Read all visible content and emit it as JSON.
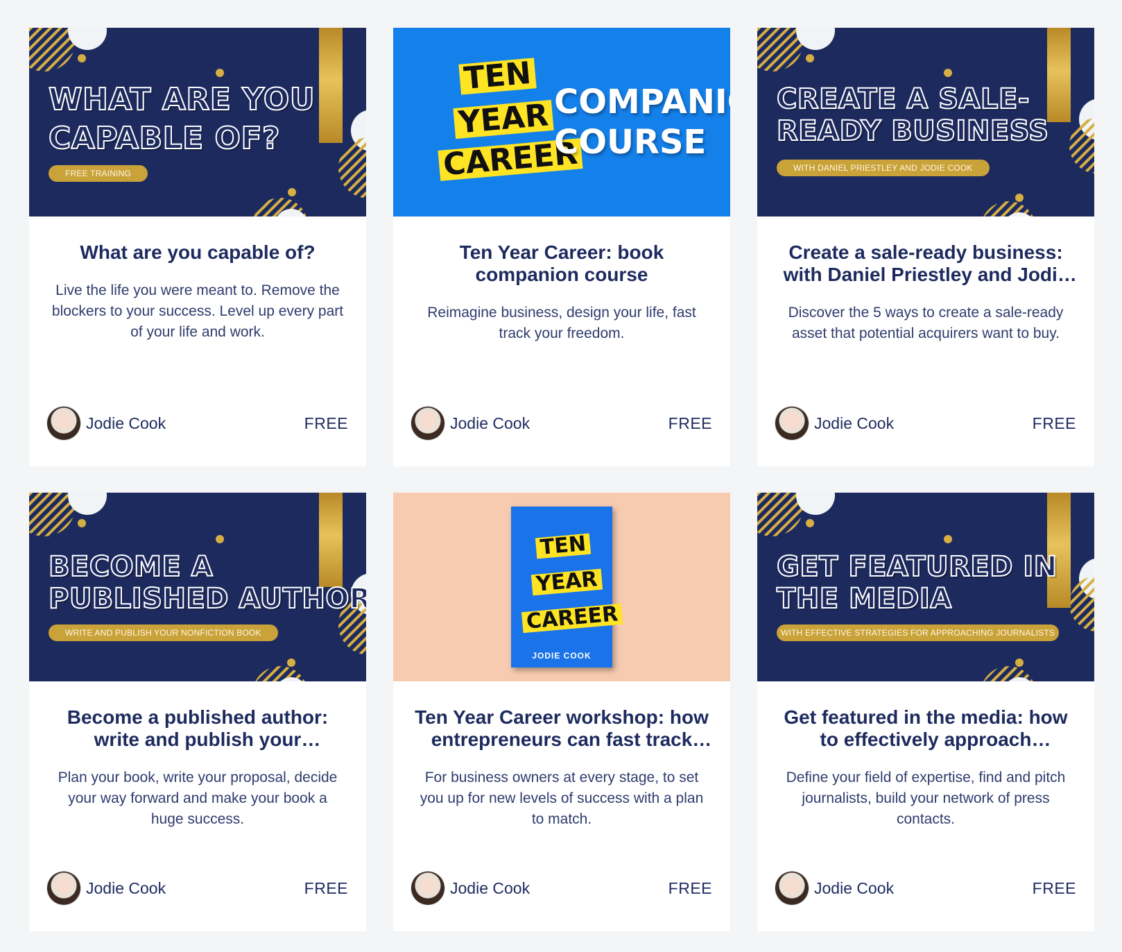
{
  "cards": [
    {
      "banner": {
        "headline_1": "WHAT ARE YOU",
        "headline_2": "CAPABLE OF?",
        "tag": "FREE TRAINING"
      },
      "title": "What are you capable of?",
      "description": "Live the life you were meant to. Remove the blockers to your success. Level up every part of your life and work.",
      "author": "Jodie Cook",
      "price": "FREE"
    },
    {
      "banner": {
        "stack_1": "TEN",
        "stack_2": "YEAR",
        "stack_3": "CAREER",
        "headline_1": "COMPANION",
        "headline_2": "COURSE"
      },
      "title": "Ten Year Career: book companion course",
      "description": "Reimagine business, design your life, fast track your freedom.",
      "author": "Jodie Cook",
      "price": "FREE"
    },
    {
      "banner": {
        "headline_1": "CREATE A SALE-",
        "headline_2": "READY BUSINESS",
        "tag": "WITH DANIEL PRIESTLEY AND JODIE COOK"
      },
      "title": "Create a sale-ready business: with Daniel Priestley and Jodie Cook",
      "description": "Discover the 5 ways to create a sale-ready asset that potential acquirers want to buy.",
      "author": "Jodie Cook",
      "price": "FREE"
    },
    {
      "banner": {
        "headline_1": "BECOME A",
        "headline_2": "PUBLISHED AUTHOR",
        "tag": "WRITE AND PUBLISH YOUR NONFICTION BOOK"
      },
      "title": "Become a published author: write and publish your nonfiction book",
      "description": "Plan your book, write your proposal, decide your way forward and make your book a huge success.",
      "author": "Jodie Cook",
      "price": "FREE"
    },
    {
      "banner": {
        "stack_1": "TEN",
        "stack_2": "YEAR",
        "stack_3": "CAREER",
        "book_author": "JODIE COOK"
      },
      "title": "Ten Year Career workshop: how entrepreneurs can fast track their freedom",
      "description": "For business owners at every stage, to set you up for new levels of success with a plan to match.",
      "author": "Jodie Cook",
      "price": "FREE"
    },
    {
      "banner": {
        "headline_1": "GET FEATURED IN",
        "headline_2": "THE MEDIA",
        "tag": "WITH EFFECTIVE STRATEGIES FOR APPROACHING JOURNALISTS"
      },
      "title": "Get featured in the media: how to effectively approach journalists",
      "description": "Define your field of expertise, find and pitch journalists, build your network of press contacts.",
      "author": "Jodie Cook",
      "price": "FREE"
    }
  ],
  "colors": {
    "navy": "#1d2a5e",
    "gold": "#c9a23a",
    "blue": "#1480ea",
    "peach": "#f7cbb0",
    "yellow": "#ffe424"
  }
}
